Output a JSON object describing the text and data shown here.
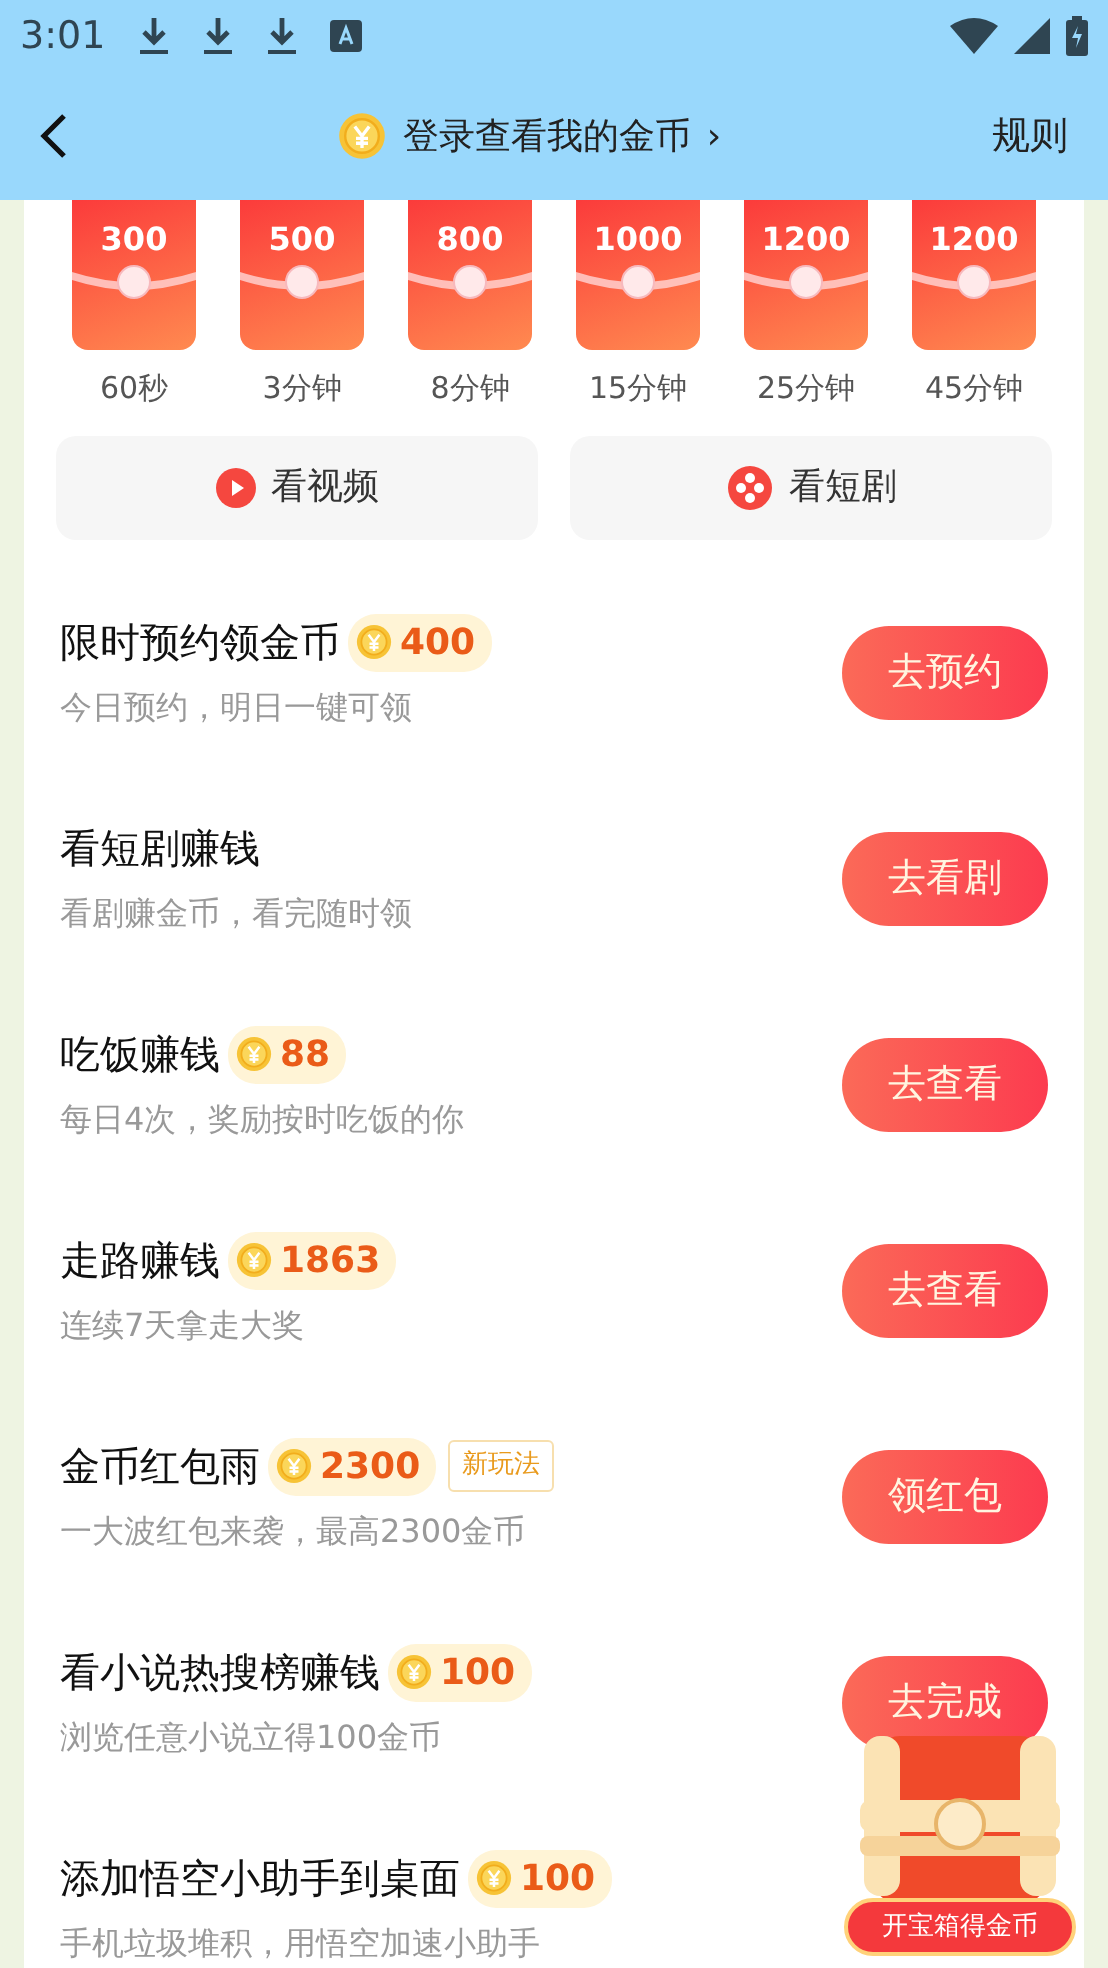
{
  "status_bar": {
    "time": "3:01"
  },
  "header": {
    "title": "登录查看我的金币",
    "chevron": "›",
    "rules": "规则"
  },
  "packets": [
    {
      "amount": "300",
      "label": "60秒"
    },
    {
      "amount": "500",
      "label": "3分钟"
    },
    {
      "amount": "800",
      "label": "8分钟"
    },
    {
      "amount": "1000",
      "label": "15分钟"
    },
    {
      "amount": "1200",
      "label": "25分钟"
    },
    {
      "amount": "1200",
      "label": "45分钟"
    }
  ],
  "shortcuts": [
    {
      "kind": "video",
      "label": "看视频"
    },
    {
      "kind": "drama",
      "label": "看短剧"
    }
  ],
  "tasks": [
    {
      "title": "限时预约领金币",
      "reward": "400",
      "subtitle": "今日预约，明日一键可领",
      "button": "去预约"
    },
    {
      "title": "看短剧赚钱",
      "subtitle": "看剧赚金币，看完随时领",
      "button": "去看剧"
    },
    {
      "title": "吃饭赚钱",
      "reward": "88",
      "subtitle": "每日4次，奖励按时吃饭的你",
      "button": "去查看"
    },
    {
      "title": "走路赚钱",
      "reward": "1863",
      "subtitle": "连续7天拿走大奖",
      "button": "去查看"
    },
    {
      "title": "金币红包雨",
      "reward": "2300",
      "tag": "新玩法",
      "subtitle": "一大波红包来袭，最高2300金币",
      "button": "领红包"
    },
    {
      "title": "看小说热搜榜赚钱",
      "reward": "100",
      "subtitle": "浏览任意小说立得100金币",
      "button": "去完成"
    },
    {
      "title": "添加悟空小助手到桌面",
      "reward": "100",
      "subtitle": "手机垃圾堆积，用悟空加速小助手"
    }
  ],
  "treasure": {
    "label": "开宝箱得金币"
  }
}
